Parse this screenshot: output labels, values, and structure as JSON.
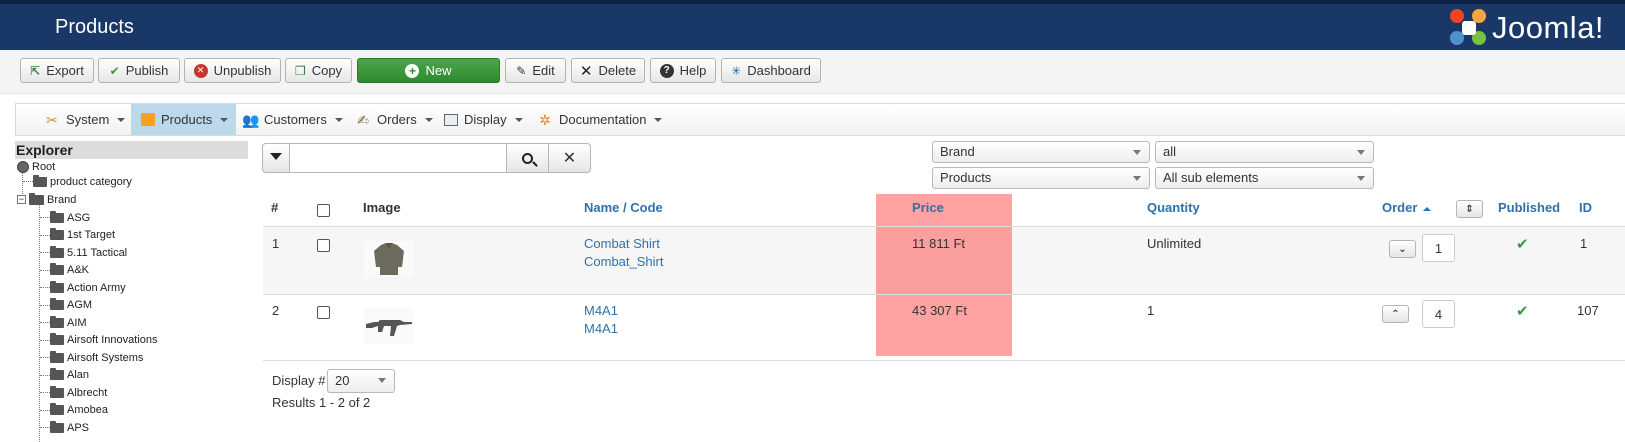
{
  "header": {
    "title": "Products",
    "logo_text": "Joomla!"
  },
  "toolbar": {
    "buttons": [
      {
        "label": "Export",
        "icon": "export-icon"
      },
      {
        "label": "Publish",
        "icon": "check-icon"
      },
      {
        "label": "Unpublish",
        "icon": "cancel-circle-icon"
      },
      {
        "label": "Copy",
        "icon": "copy-icon"
      },
      {
        "label": "New",
        "icon": "plus-circle-icon"
      },
      {
        "label": "Edit",
        "icon": "edit-icon"
      },
      {
        "label": "Delete",
        "icon": "delete-x-icon"
      },
      {
        "label": "Help",
        "icon": "question-icon"
      },
      {
        "label": "Dashboard",
        "icon": "dashboard-icon"
      }
    ]
  },
  "menu": {
    "items": [
      {
        "label": "System",
        "icon": "tools-icon"
      },
      {
        "label": "Products",
        "icon": "box-icon",
        "active": true
      },
      {
        "label": "Customers",
        "icon": "users-icon"
      },
      {
        "label": "Orders",
        "icon": "orders-icon"
      },
      {
        "label": "Display",
        "icon": "display-icon"
      },
      {
        "label": "Documentation",
        "icon": "gears-icon"
      }
    ]
  },
  "explorer": {
    "title": "Explorer",
    "root": "Root",
    "nodes": [
      "product category",
      "Brand"
    ],
    "brands": [
      "ASG",
      "1st Target",
      "5.11 Tactical",
      "A&K",
      "Action Army",
      "AGM",
      "AIM",
      "Airsoft Innovations",
      "Airsoft Systems",
      "Alan",
      "Albrecht",
      "Amobea",
      "APS"
    ]
  },
  "filters": {
    "search_value": "",
    "field_select": "Brand",
    "value_select": "all",
    "type_select": "Products",
    "scope_select": "All sub elements"
  },
  "table": {
    "headers": {
      "num": "#",
      "image": "Image",
      "name_code": "Name / Code",
      "price": "Price",
      "quantity": "Quantity",
      "order": "Order",
      "published": "Published",
      "id": "ID"
    },
    "rows": [
      {
        "num": "1",
        "name": "Combat Shirt",
        "code": "Combat_Shirt",
        "price": "11 811 Ft",
        "quantity": "Unlimited",
        "order": "1",
        "id": "1"
      },
      {
        "num": "2",
        "name": "M4A1",
        "code": "M4A1",
        "price": "43 307 Ft",
        "quantity": "1",
        "order": "4",
        "id": "107"
      }
    ]
  },
  "pagination": {
    "display_label": "Display #",
    "display_value": "20",
    "results_text": "Results 1 - 2 of 2"
  },
  "colors": {
    "header_bg": "#1a3867",
    "new_button": "#3a993a",
    "link": "#3071a9",
    "price_highlight": "#ff6464",
    "published_check": "#3b9a3b"
  }
}
